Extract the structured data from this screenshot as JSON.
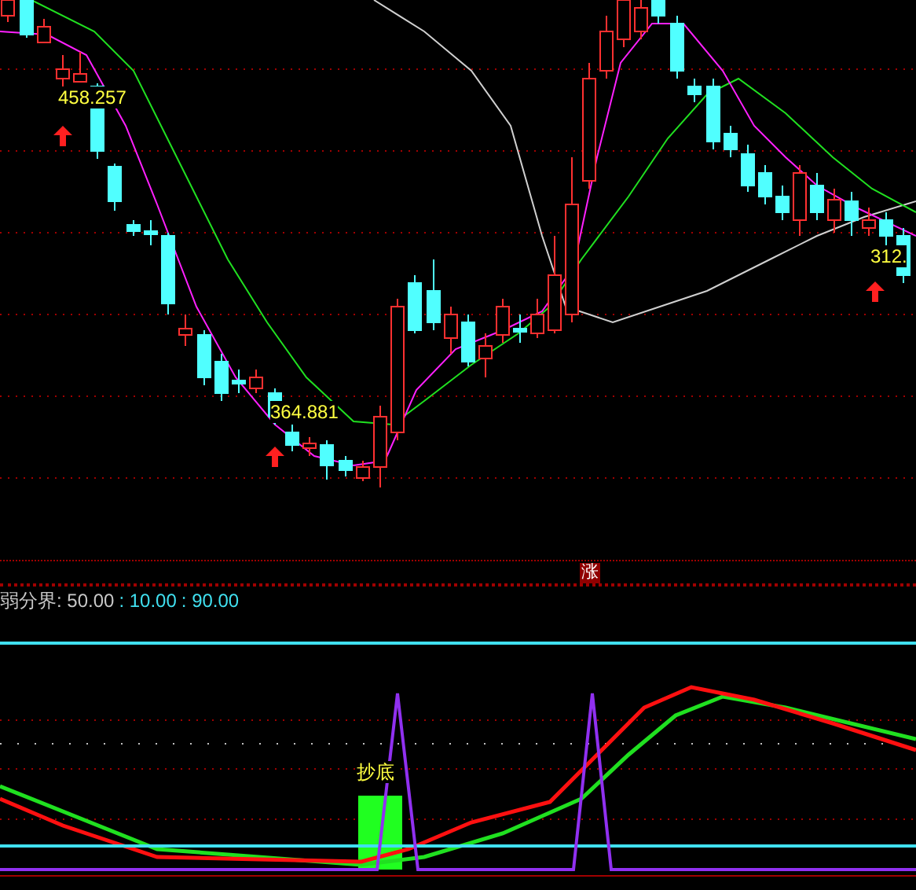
{
  "price_labels": [
    {
      "text": "458.257"
    },
    {
      "text": "364.881"
    },
    {
      "text": "312."
    }
  ],
  "badge": "涨",
  "indicator_legend": [
    {
      "text": "弱分界: 50.00",
      "color": "#c8c8c8"
    },
    {
      "text": ": 10.00",
      "color": "#40e0f0"
    },
    {
      "text": ": 90.00",
      "color": "#40e0f0"
    }
  ],
  "signal_label": "抄底"
}
